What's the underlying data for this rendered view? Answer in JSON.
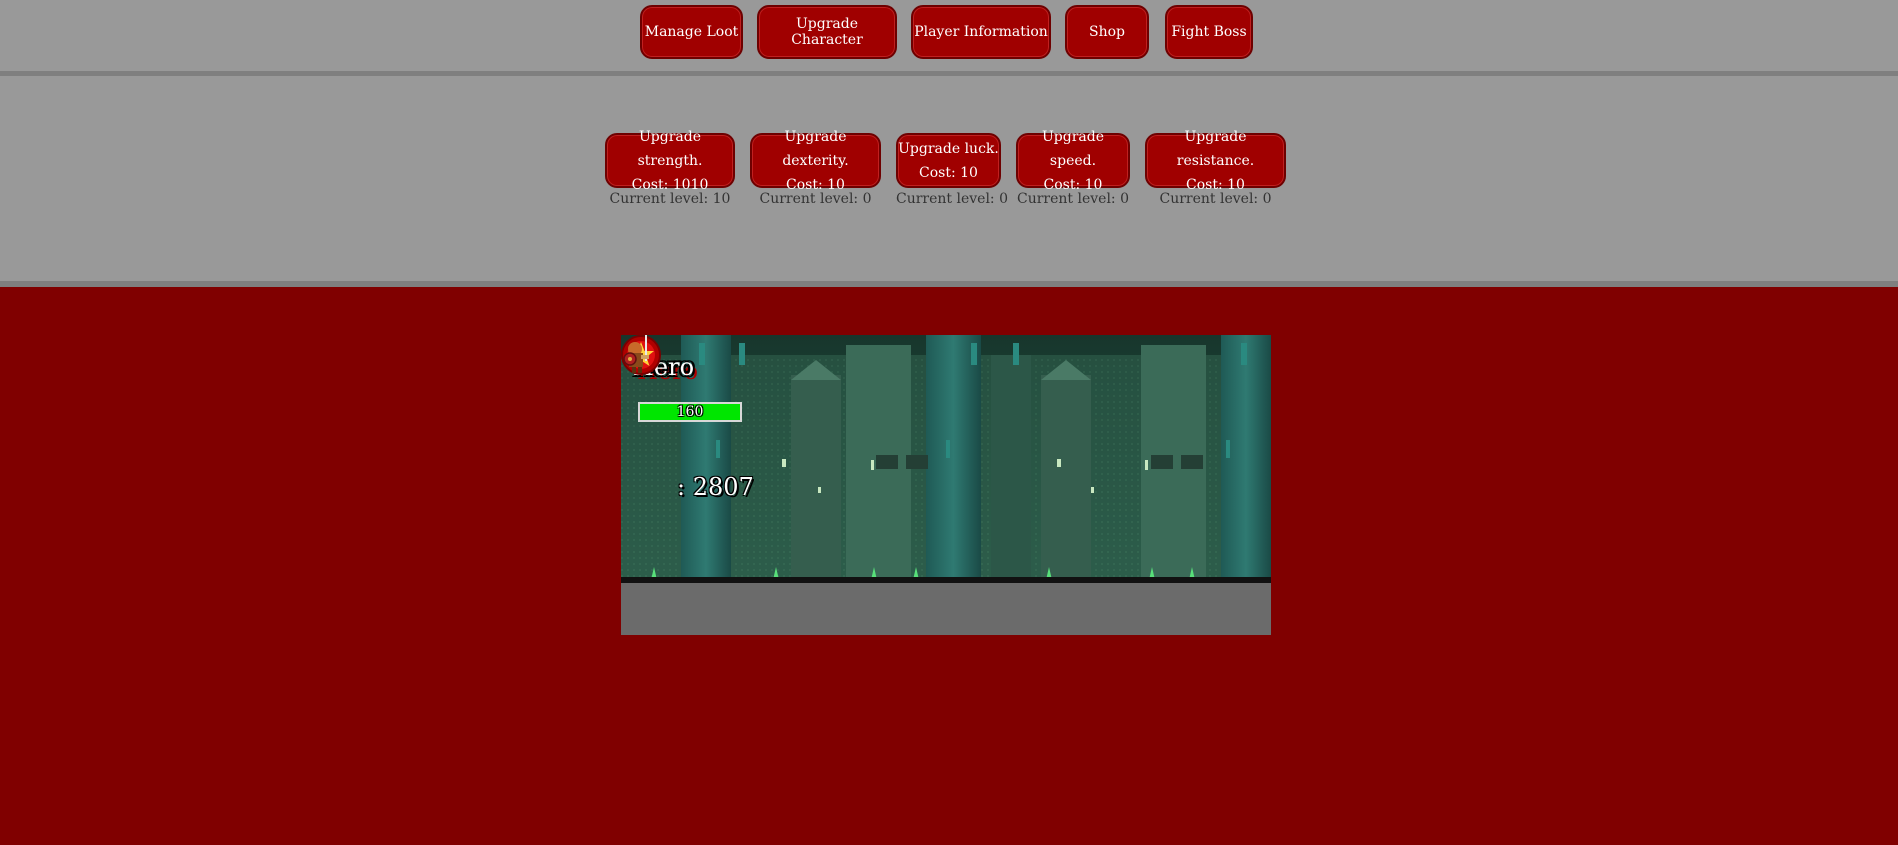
{
  "nav": {
    "buttons": [
      {
        "label": "Manage Loot"
      },
      {
        "label": "Upgrade Character"
      },
      {
        "label": "Player Information"
      },
      {
        "label": "Shop"
      },
      {
        "label": "Fight Boss"
      }
    ]
  },
  "upgrades": [
    {
      "title": "Upgrade strength.",
      "cost": "Cost: 1010",
      "level": "Current level: 10"
    },
    {
      "title": "Upgrade dexterity.",
      "cost": "Cost: 10",
      "level": "Current level: 0"
    },
    {
      "title": "Upgrade luck.",
      "cost": "Cost: 10",
      "level": "Current level: 0"
    },
    {
      "title": "Upgrade speed.",
      "cost": "Cost: 10",
      "level": "Current level: 0"
    },
    {
      "title": "Upgrade resistance.",
      "cost": "Cost: 10",
      "level": "Current level: 0"
    }
  ],
  "game": {
    "hero_name": "Hero",
    "hp_text": "160",
    "hp_fraction": 1.0,
    "gold_text": ": 2807",
    "coin_icon": "star-coin-icon",
    "hero_icon": "knight-sprite-icon"
  },
  "colors": {
    "page_background": "#800000",
    "panel_background": "#999999",
    "button": "#a00000",
    "hp_bar": "#00e600"
  }
}
